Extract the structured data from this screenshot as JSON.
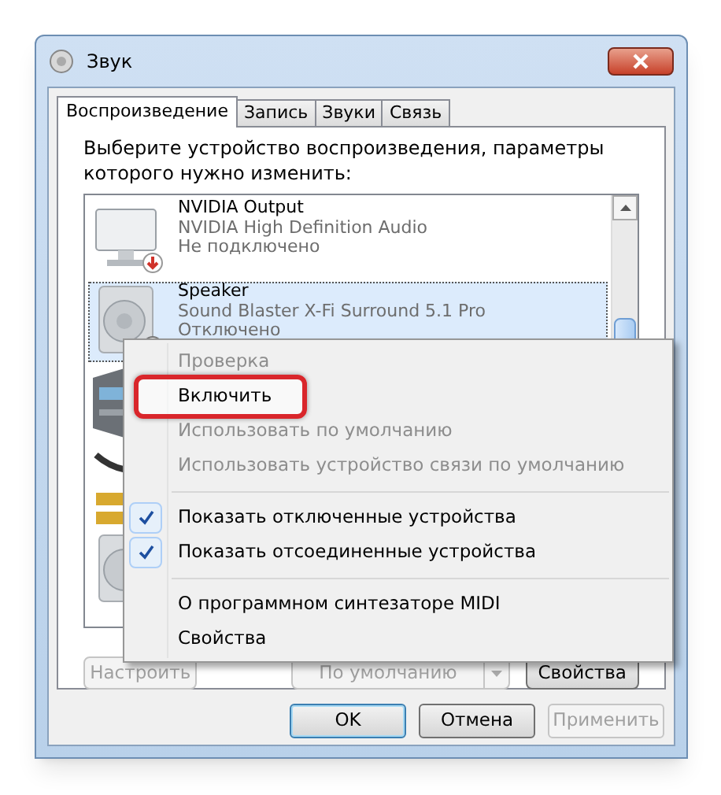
{
  "window": {
    "title": "Звук"
  },
  "tabs": [
    {
      "label": "Воспроизведение",
      "selected": true
    },
    {
      "label": "Запись",
      "selected": false
    },
    {
      "label": "Звуки",
      "selected": false
    },
    {
      "label": "Связь",
      "selected": false
    }
  ],
  "instruction": "Выберите устройство воспроизведения, параметры которого нужно изменить:",
  "devices": [
    {
      "kind": "monitor",
      "name": "NVIDIA Output",
      "driver": "NVIDIA High Definition Audio",
      "status": "Не подключено",
      "selected": false
    },
    {
      "kind": "speaker",
      "name": "Speaker",
      "driver": "Sound Blaster X-Fi Surround 5.1 Pro",
      "status": "Отключено",
      "selected": true
    }
  ],
  "context_menu": [
    {
      "kind": "item",
      "label": "Проверка",
      "disabled": true,
      "highlighted": false
    },
    {
      "kind": "item",
      "label": "Включить",
      "disabled": false,
      "highlighted": true
    },
    {
      "kind": "item",
      "label": "Использовать по умолчанию",
      "disabled": true,
      "highlighted": false
    },
    {
      "kind": "item",
      "label": "Использовать устройство связи по умолчанию",
      "disabled": true,
      "highlighted": false
    },
    {
      "kind": "separator"
    },
    {
      "kind": "check",
      "label": "Показать отключенные устройства",
      "checked": true
    },
    {
      "kind": "check",
      "label": "Показать отсоединенные устройства",
      "checked": true
    },
    {
      "kind": "separator"
    },
    {
      "kind": "item",
      "label": "О программном синтезаторе MIDI",
      "disabled": false,
      "highlighted": false
    },
    {
      "kind": "item",
      "label": "Свойства",
      "disabled": false,
      "highlighted": false
    }
  ],
  "panel_buttons": [
    {
      "kind": "button",
      "label": "Настроить",
      "disabled": true
    },
    {
      "kind": "dropdown",
      "label": "По умолчанию",
      "disabled": true
    },
    {
      "kind": "button",
      "label": "Свойства",
      "disabled": false
    }
  ],
  "dialog_buttons": [
    {
      "label": "OK",
      "disabled": false,
      "default": true
    },
    {
      "label": "Отмена",
      "disabled": false,
      "default": false
    },
    {
      "label": "Применить",
      "disabled": true,
      "default": false
    }
  ]
}
